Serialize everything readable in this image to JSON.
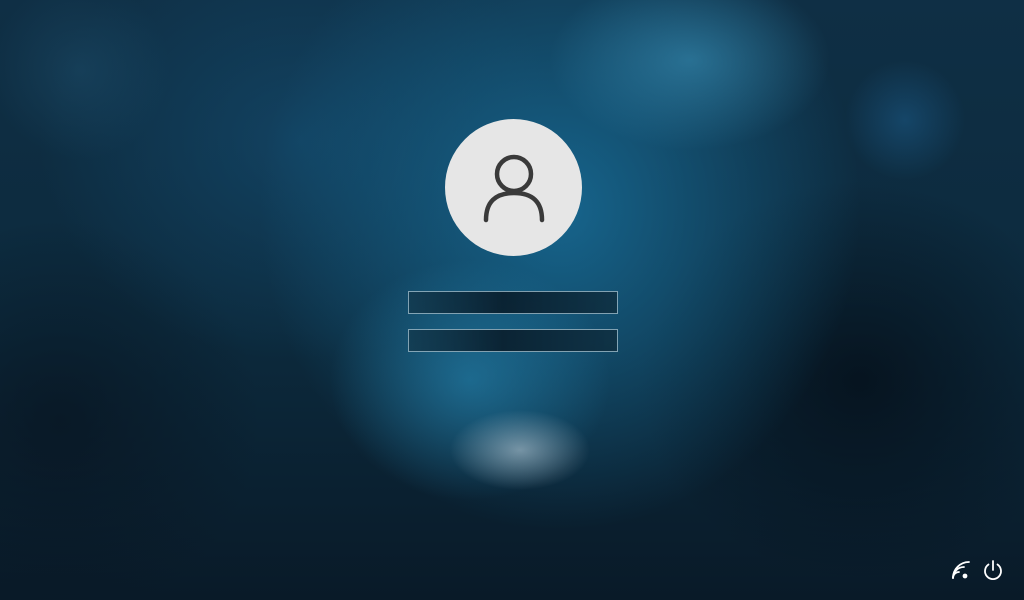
{
  "login": {
    "avatar_icon": "user-silhouette-icon",
    "username": {
      "value": "",
      "placeholder": ""
    },
    "password": {
      "value": "",
      "placeholder": ""
    }
  },
  "tray": {
    "network_icon": "wifi-signal-icon",
    "power_icon": "power-icon"
  },
  "colors": {
    "avatar_bg": "#e6e6e6",
    "avatar_glyph": "#3a3a3a",
    "field_border": "#aac8d7",
    "background_accent": "#17688f"
  }
}
